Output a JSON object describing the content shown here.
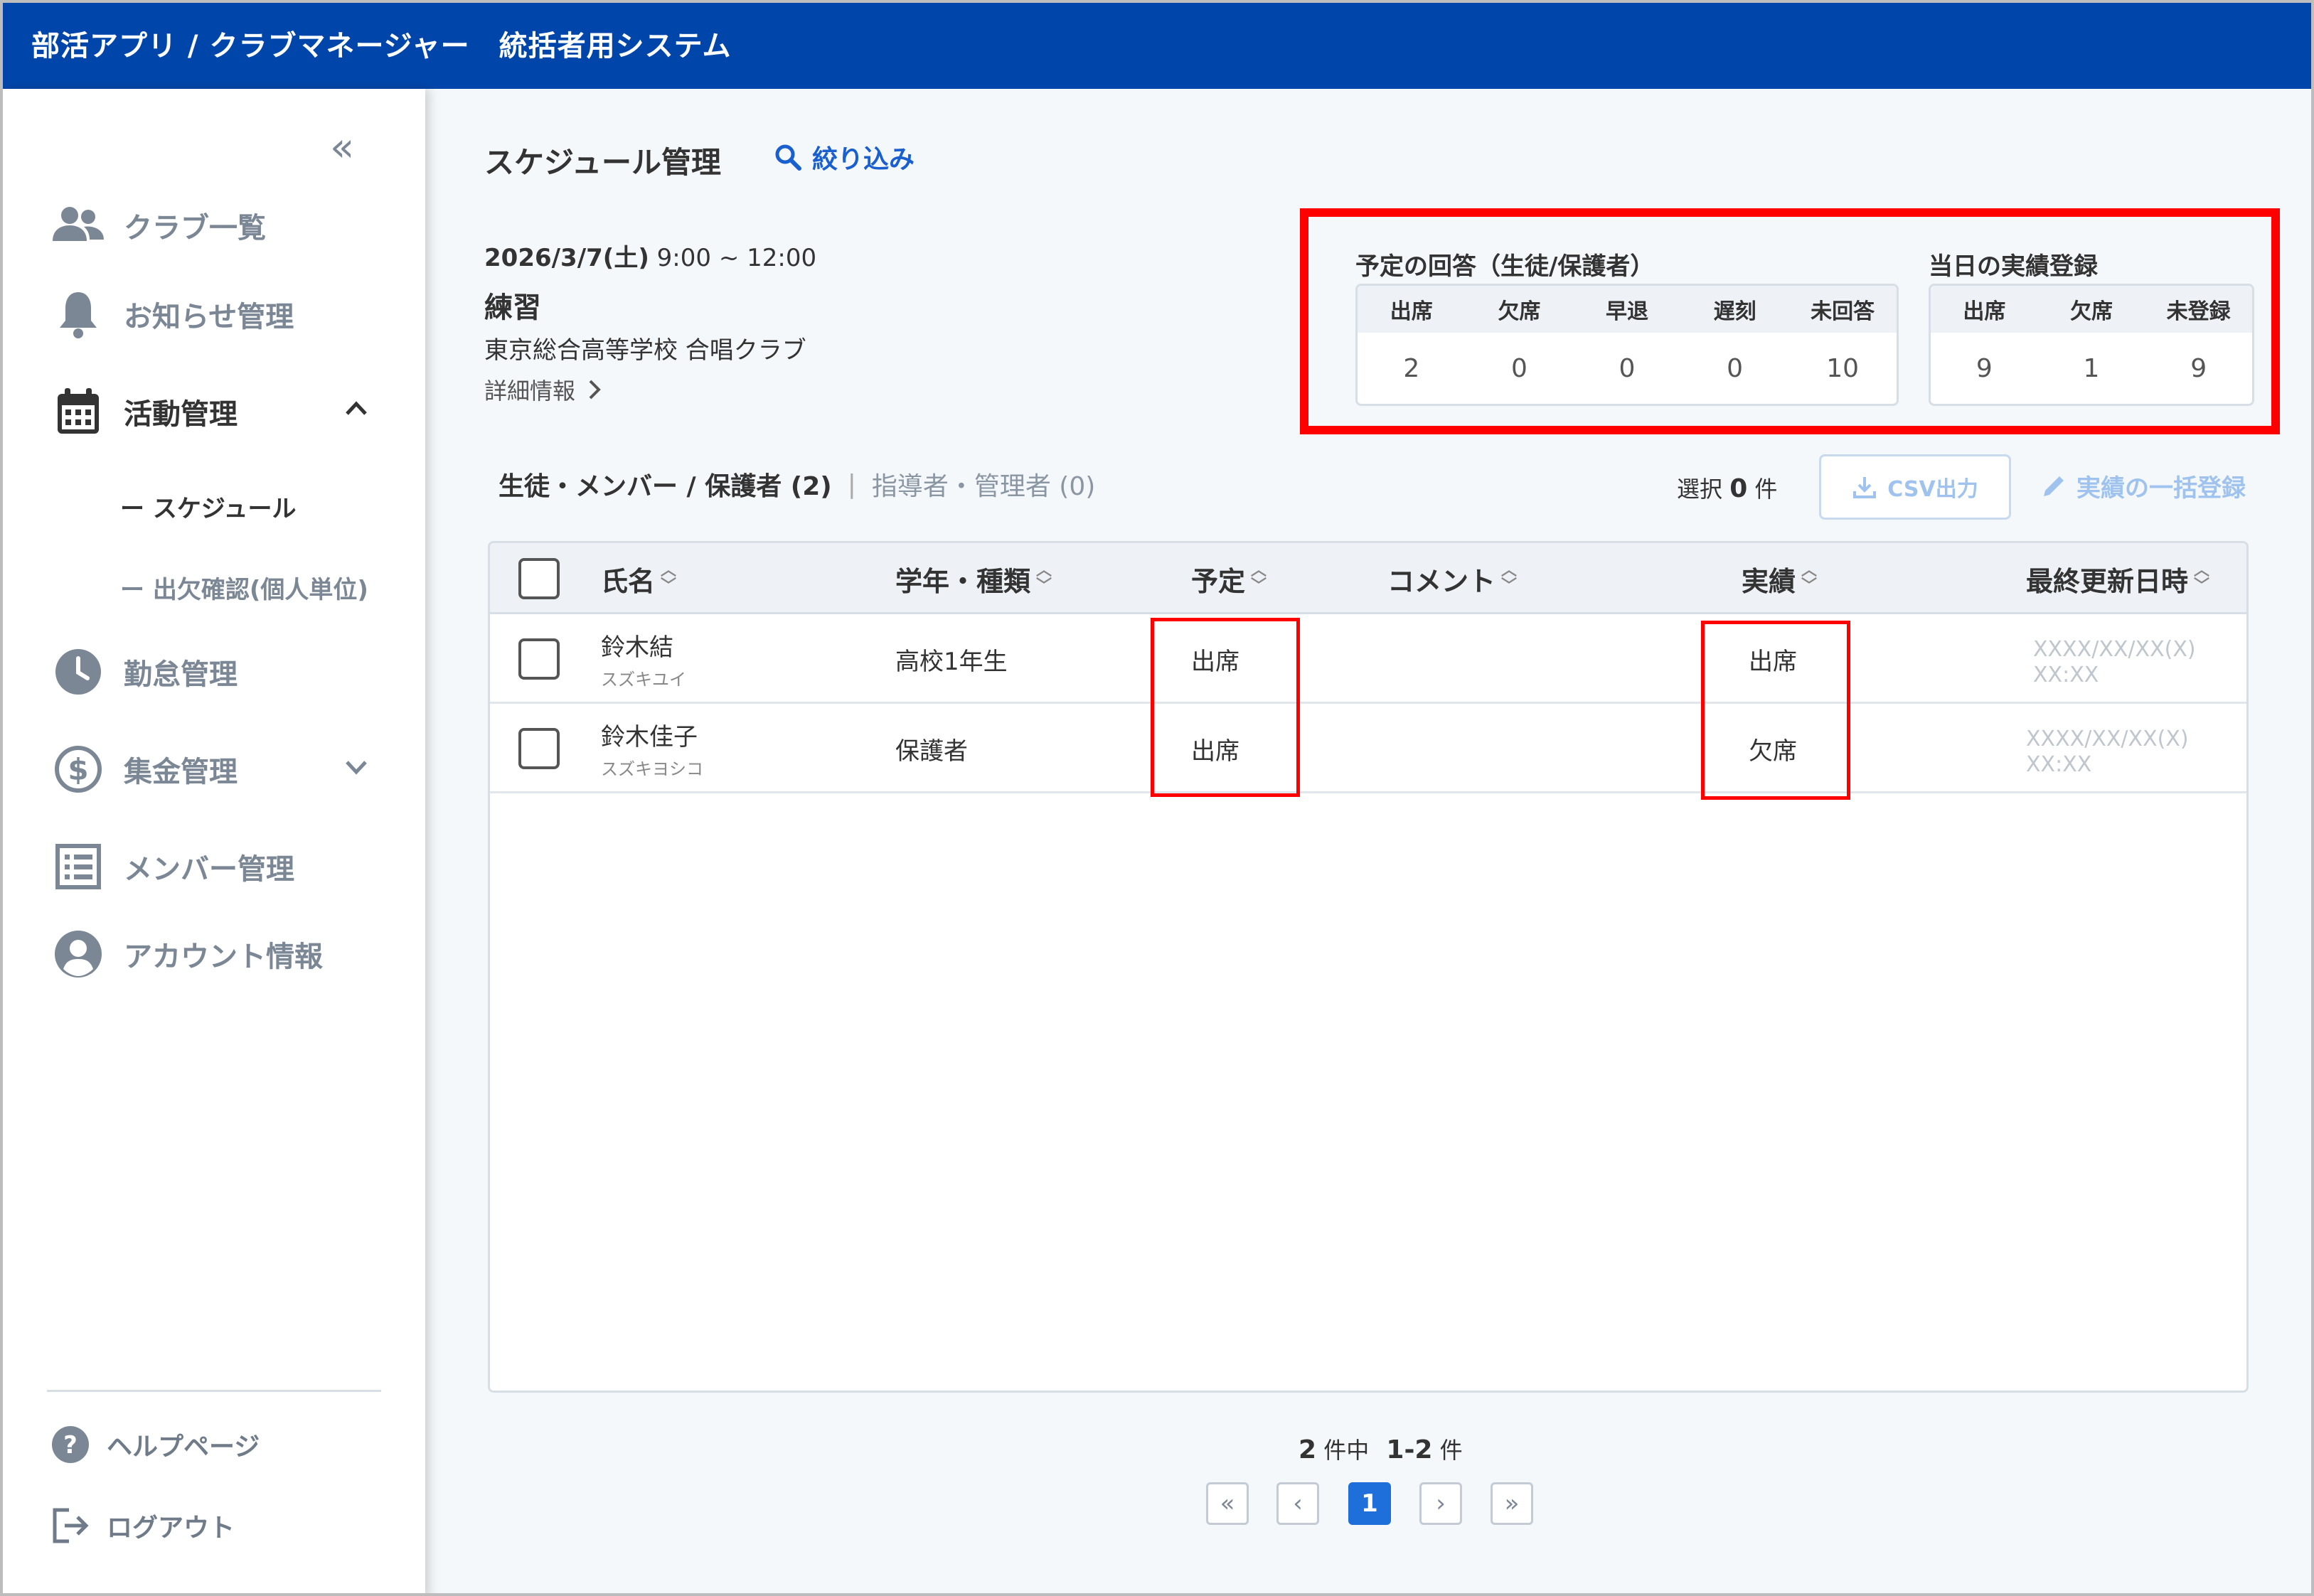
{
  "header": {
    "title": "部活アプリ / クラブマネージャー　統括者用システム"
  },
  "sidebar": {
    "collapse_glyph": "«",
    "items": [
      {
        "label": "クラブ一覧",
        "icon": "users-icon"
      },
      {
        "label": "お知らせ管理",
        "icon": "bell-icon"
      },
      {
        "label": "活動管理",
        "icon": "calendar-icon"
      },
      {
        "label": "勤怠管理",
        "icon": "clock-icon"
      },
      {
        "label": "集金管理",
        "icon": "dollar-icon"
      },
      {
        "label": "メンバー管理",
        "icon": "list-icon"
      },
      {
        "label": "アカウント情報",
        "icon": "account-icon"
      }
    ],
    "sub_items": [
      {
        "label": "ー スケジュール"
      },
      {
        "label": "ー 出欠確認(個人単位)"
      }
    ],
    "footer": [
      {
        "label": "ヘルプページ",
        "icon": "help-icon"
      },
      {
        "label": "ログアウト",
        "icon": "logout-icon"
      }
    ]
  },
  "main": {
    "page_title": "スケジュール管理",
    "filter_label": "絞り込み",
    "event": {
      "date": "2026/3/7(土)",
      "time": "9:00 ~ 12:00",
      "name": "練習",
      "club": "東京総合高等学校 合唱クラブ",
      "detail_link": "詳細情報"
    },
    "stats_response": {
      "title": "予定の回答（生徒/保護者）",
      "headers": [
        "出席",
        "欠席",
        "早退",
        "遅刻",
        "未回答"
      ],
      "values": [
        "2",
        "0",
        "0",
        "0",
        "10"
      ]
    },
    "stats_actual": {
      "title": "当日の実績登録",
      "headers": [
        "出席",
        "欠席",
        "未登録"
      ],
      "values": [
        "9",
        "1",
        "9"
      ]
    },
    "tabs": {
      "active": "生徒・メンバー / 保護者 (2)",
      "separator": "|",
      "inactive": "指導者・管理者 (0)"
    },
    "selection": {
      "label": "選択",
      "count": "0",
      "unit": "件"
    },
    "csv_button": "CSV出力",
    "bulk_button": "実績の一括登録",
    "table": {
      "columns": [
        "氏名",
        "学年・種類",
        "予定",
        "コメント",
        "実績",
        "最終更新日時"
      ],
      "rows": [
        {
          "name": "鈴木結",
          "kana": "スズキユイ",
          "grade": "高校1年生",
          "plan": "出席",
          "comment": "",
          "actual": "出席",
          "updated": "XXXX/XX/XX(X)　XX:XX"
        },
        {
          "name": "鈴木佳子",
          "kana": "スズキヨシコ",
          "grade": "保護者",
          "plan": "出席",
          "comment": "",
          "actual": "欠席",
          "updated": "XXXX/XX/XX(X)　XX:XX"
        }
      ]
    },
    "pagination": {
      "total": "2",
      "total_unit": "件中",
      "range": "1-2",
      "range_unit": "件",
      "current_page": "1",
      "first": "«",
      "prev": "‹",
      "next": "›",
      "last": "»"
    }
  }
}
